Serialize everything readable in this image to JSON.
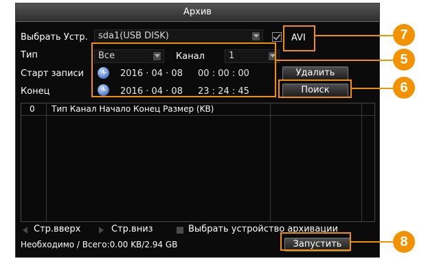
{
  "dialog": {
    "title": "Архив"
  },
  "device": {
    "label": "Выбрать Устр.",
    "value": "sda1(USB DISK)",
    "format_label": "AVI"
  },
  "filter": {
    "type_label": "Тип",
    "type_value": "Все",
    "channel_label": "Канал",
    "channel_value": "1"
  },
  "start": {
    "label": "Старт записи",
    "date": "2016 · 04 · 08",
    "time": "00 : 00 : 00"
  },
  "end": {
    "label": "Конец",
    "date": "2016 · 04 · 08",
    "time": "23 : 24 : 45"
  },
  "buttons": {
    "delete": "Удалить",
    "search": "Поиск",
    "start": "Запустить"
  },
  "table": {
    "index_header": "0",
    "columns_header": "Тип Канал Начало Конец Размер (KB)"
  },
  "nav": {
    "page_up": "Стр.вверх",
    "page_down": "Стр.вниз",
    "select_device": "Выбрать устройство архивации"
  },
  "status": {
    "size_text": "Необходимо / Всего:0.00 KB/2.94 GB"
  },
  "callouts": [
    "7",
    "5",
    "6",
    "8"
  ],
  "colors": {
    "accent": "#f39200",
    "background": "#0b0b0b"
  }
}
